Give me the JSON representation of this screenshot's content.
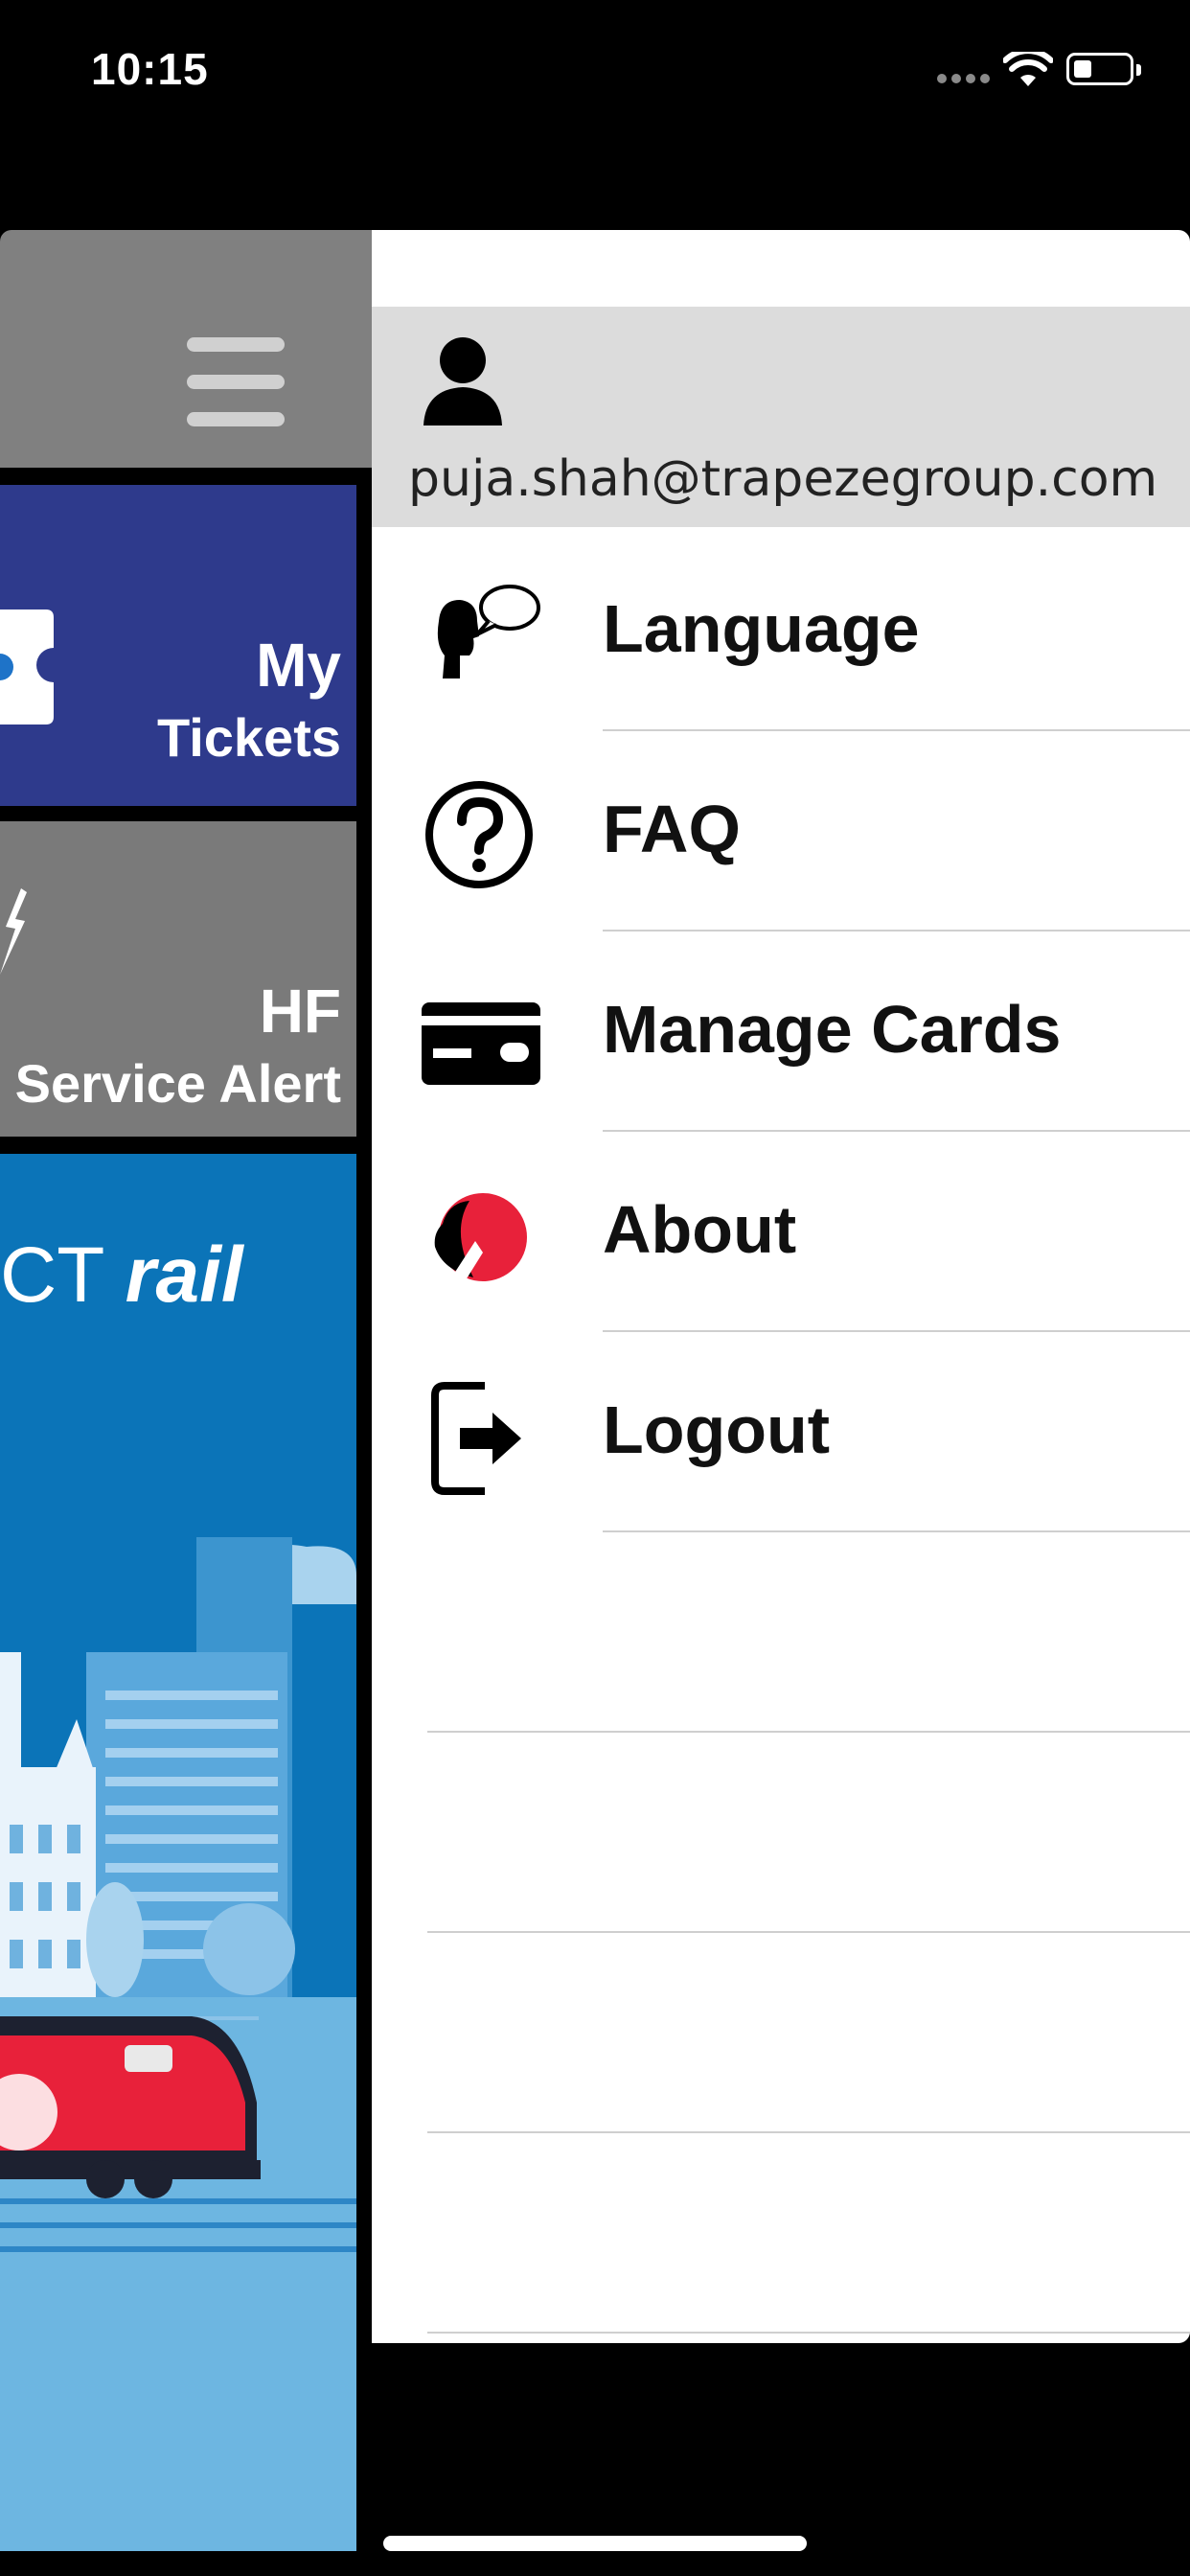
{
  "status_bar": {
    "time": "10:15"
  },
  "tiles": {
    "tickets_label_line1": "My",
    "tickets_label_line2": "Tickets",
    "alert_label_line1": "HF",
    "alert_label_line2": "Service Alert",
    "rail_brand_partial": "CT",
    "rail_brand_bold": "rail"
  },
  "drawer": {
    "user_email": "puja.shah@trapezegroup.com",
    "menu": [
      {
        "label": "Language",
        "icon": "language-speech-icon"
      },
      {
        "label": "FAQ",
        "icon": "question-icon"
      },
      {
        "label": "Manage Cards",
        "icon": "card-icon"
      },
      {
        "label": "About",
        "icon": "trapeze-logo-icon"
      },
      {
        "label": "Logout",
        "icon": "logout-icon"
      }
    ]
  },
  "colors": {
    "tickets_tile": "#2e3a8c",
    "alert_tile": "#7a7a7a",
    "rail_tile": "#0b74b8",
    "topbar": "#808080",
    "drawer_bg": "#ffffff",
    "profile_bg": "#dcdcdc"
  }
}
